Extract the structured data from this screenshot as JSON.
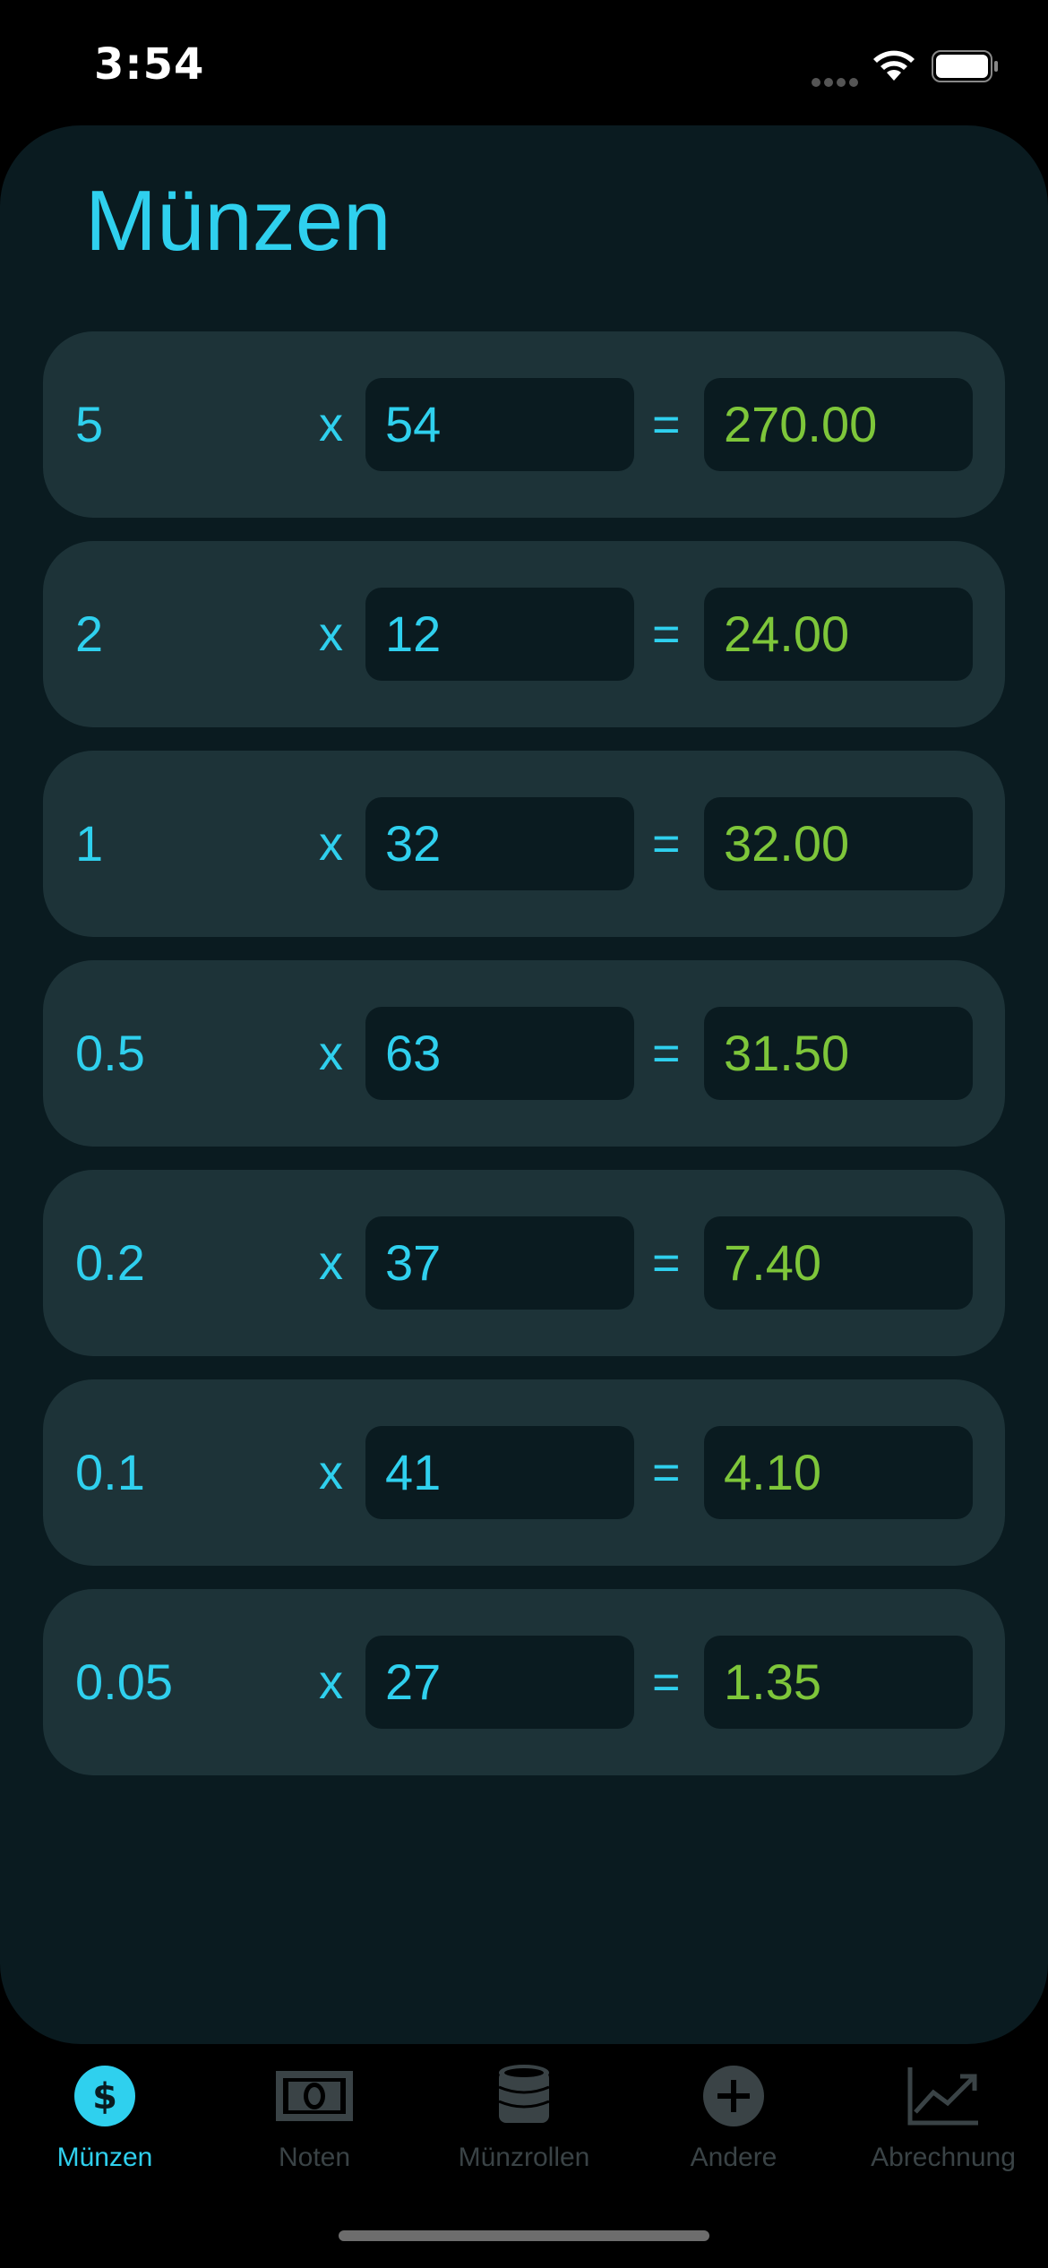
{
  "status_bar": {
    "time": "3:54"
  },
  "page": {
    "title": "Münzen"
  },
  "operators": {
    "times": "x",
    "equals": "="
  },
  "coins": [
    {
      "denomination": "5",
      "quantity": "54",
      "total": "270.00"
    },
    {
      "denomination": "2",
      "quantity": "12",
      "total": "24.00"
    },
    {
      "denomination": "1",
      "quantity": "32",
      "total": "32.00"
    },
    {
      "denomination": "0.5",
      "quantity": "63",
      "total": "31.50"
    },
    {
      "denomination": "0.2",
      "quantity": "37",
      "total": "7.40"
    },
    {
      "denomination": "0.1",
      "quantity": "41",
      "total": "4.10"
    },
    {
      "denomination": "0.05",
      "quantity": "27",
      "total": "1.35"
    }
  ],
  "tabs": [
    {
      "label": "Münzen",
      "icon": "dollar-circle-icon",
      "active": true
    },
    {
      "label": "Noten",
      "icon": "banknote-icon",
      "active": false
    },
    {
      "label": "Münzrollen",
      "icon": "coin-stack-icon",
      "active": false
    },
    {
      "label": "Andere",
      "icon": "plus-circle-icon",
      "active": false
    },
    {
      "label": "Abrechnung",
      "icon": "chart-line-icon",
      "active": false
    }
  ],
  "colors": {
    "accent": "#2fd0ee",
    "total_text": "#7ec63a",
    "panel_background": "#0a1b20",
    "row_background": "#1d3338",
    "inactive_tab": "#3a4346"
  }
}
